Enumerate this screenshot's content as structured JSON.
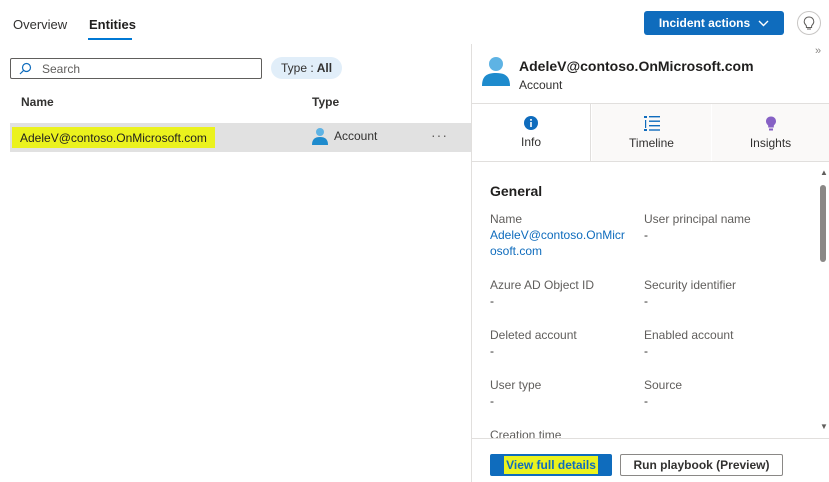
{
  "tabs": {
    "overview": "Overview",
    "entities": "Entities"
  },
  "header": {
    "incident_actions": "Incident actions"
  },
  "search": {
    "placeholder": "Search"
  },
  "filter": {
    "label": "Type :",
    "value": "All"
  },
  "table": {
    "columns": [
      "Name",
      "Type"
    ],
    "rows": [
      {
        "name": "AdeleV@contoso.OnMicrosoft.com",
        "type": "Account",
        "more": "···"
      }
    ]
  },
  "entity": {
    "title": "AdeleV@contoso.OnMicrosoft.com",
    "subtitle": "Account"
  },
  "panel_tabs": [
    "Info",
    "Timeline",
    "Insights"
  ],
  "details": {
    "section": "General",
    "fields": [
      {
        "label": "Name",
        "value": "AdeleV@contoso.OnMicrosoft.com"
      },
      {
        "label": "User principal name",
        "value": "-"
      },
      {
        "label": "Azure AD Object ID",
        "value": "-"
      },
      {
        "label": "Security identifier",
        "value": "-"
      },
      {
        "label": "Deleted account",
        "value": "-"
      },
      {
        "label": "Enabled account",
        "value": "-"
      },
      {
        "label": "User type",
        "value": "-"
      },
      {
        "label": "Source",
        "value": "-"
      },
      {
        "label": "Creation time",
        "value": ""
      }
    ]
  },
  "footer": {
    "view_full_details": "View full details",
    "run_playbook": "Run playbook (Preview)"
  },
  "colors": {
    "accent": "#0f6cbd",
    "highlight": "#ebf21d",
    "selected_row": "#e1e1e1",
    "filter_pill": "#e1eef9"
  }
}
